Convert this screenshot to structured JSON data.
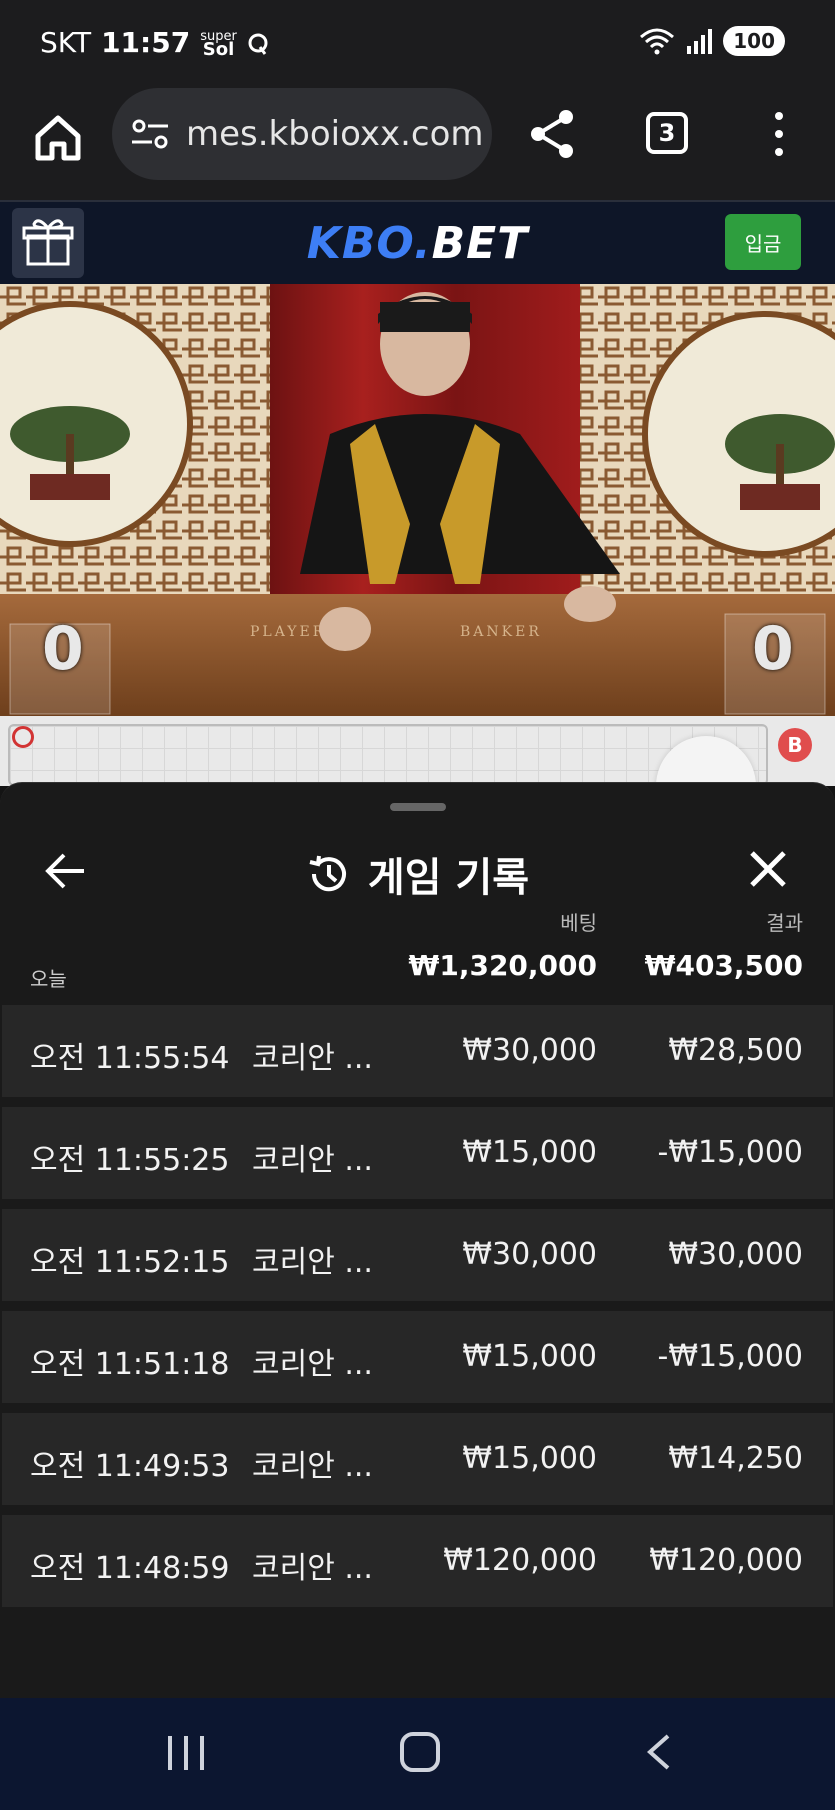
{
  "status_bar": {
    "carrier": "SKT",
    "time": "11:57",
    "app_badge_top": "super",
    "app_badge_bottom": "Sol",
    "battery": "100"
  },
  "browser": {
    "url": "mes.kboioxx.com",
    "tab_count": "3"
  },
  "site": {
    "logo_part1": "KBO.",
    "logo_part2": "BET",
    "deposit_label": "입금"
  },
  "video": {
    "player_score": "0",
    "banker_score": "0",
    "table_player_label": "PLAYER",
    "table_banker_label": "BANKER"
  },
  "roadmap": {
    "banker_badge": "B"
  },
  "history": {
    "title": "게임 기록",
    "bet_label": "베팅",
    "result_label": "결과",
    "today_label": "오늘",
    "total_bet": "₩1,320,000",
    "total_result": "₩403,500",
    "rows": [
      {
        "time": "오전 11:55:54",
        "game": "코리안 ...",
        "bet": "₩30,000",
        "result": "₩28,500"
      },
      {
        "time": "오전 11:55:25",
        "game": "코리안 ...",
        "bet": "₩15,000",
        "result": "-₩15,000"
      },
      {
        "time": "오전 11:52:15",
        "game": "코리안 ...",
        "bet": "₩30,000",
        "result": "₩30,000"
      },
      {
        "time": "오전 11:51:18",
        "game": "코리안 ...",
        "bet": "₩15,000",
        "result": "-₩15,000"
      },
      {
        "time": "오전 11:49:53",
        "game": "코리안 ...",
        "bet": "₩15,000",
        "result": "₩14,250"
      },
      {
        "time": "오전 11:48:59",
        "game": "코리안 ...",
        "bet": "₩120,000",
        "result": "₩120,000"
      }
    ]
  },
  "colors": {
    "accent_blue": "#3d7ef5",
    "deposit_green": "#2e9e3e",
    "sheet_bg": "#1a1a1a",
    "row_bg": "#272727"
  },
  "icons": [
    "home-icon",
    "site-settings-icon",
    "share-icon",
    "tabs-icon",
    "more-icon",
    "gift-icon",
    "back-arrow-icon",
    "history-icon",
    "close-icon"
  ]
}
